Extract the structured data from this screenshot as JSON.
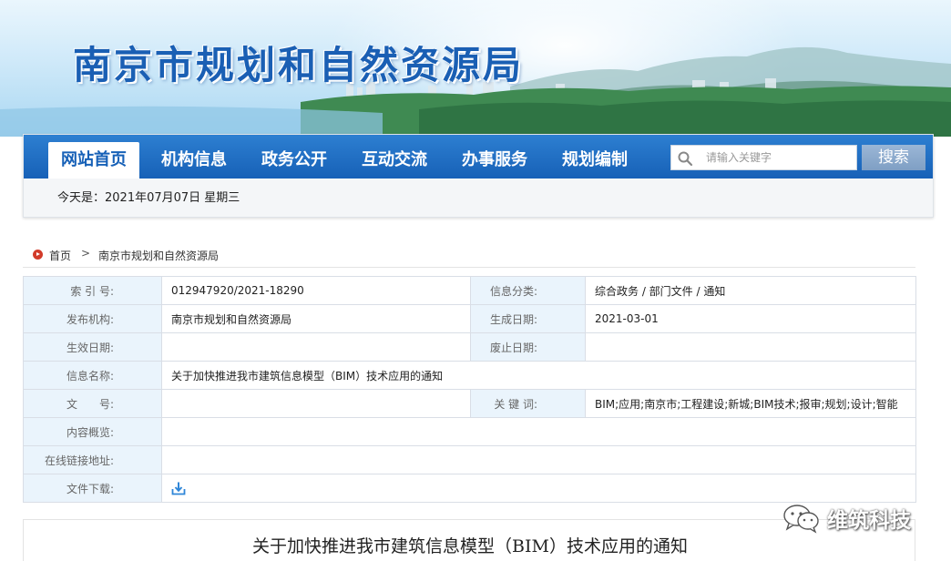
{
  "header": {
    "site_title": "南京市规划和自然资源局"
  },
  "nav": {
    "items": [
      {
        "label": "网站首页",
        "active": true
      },
      {
        "label": "机构信息",
        "active": false
      },
      {
        "label": "政务公开",
        "active": false
      },
      {
        "label": "互动交流",
        "active": false
      },
      {
        "label": "办事服务",
        "active": false
      },
      {
        "label": "规划编制",
        "active": false
      }
    ],
    "search": {
      "placeholder": "请输入关键字",
      "button_label": "搜索",
      "icon": "search-icon"
    },
    "date_text": "今天是：2021年07月07日 星期三"
  },
  "breadcrumb": {
    "home": "首页",
    "separator": ">",
    "current": "南京市规划和自然资源局"
  },
  "info": {
    "index_label": "索 引 号:",
    "index_value": "012947920/2021-18290",
    "category_label": "信息分类:",
    "category_value": "综合政务 / 部门文件 / 通知",
    "publisher_label": "发布机构:",
    "publisher_value": "南京市规划和自然资源局",
    "created_label": "生成日期:",
    "created_value": "2021-03-01",
    "effective_label": "生效日期:",
    "effective_value": "",
    "expiry_label": "废止日期:",
    "expiry_value": "",
    "name_label": "信息名称:",
    "name_value": "关于加快推进我市建筑信息模型（BIM）技术应用的通知",
    "docno_label": "文　　号:",
    "docno_value": "",
    "keywords_label": "关 键 词:",
    "keywords_value": "BIM;应用;南京市;工程建设;新城;BIM技术;报审;规划;设计;智能",
    "summary_label": "内容概览:",
    "summary_value": "",
    "link_label": "在线链接地址:",
    "link_value": "",
    "download_label": "文件下载:",
    "download_icon": "download-icon"
  },
  "article": {
    "title": "关于加快推进我市建筑信息模型（BIM）技术应用的通知"
  },
  "watermark": {
    "text": "维筑科技",
    "icon": "wechat-icon"
  },
  "colors": {
    "nav_blue": "#1761b7",
    "title_blue": "#1a5fb4",
    "label_bg": "#eaf4fc",
    "home_red": "#d23b2a"
  }
}
